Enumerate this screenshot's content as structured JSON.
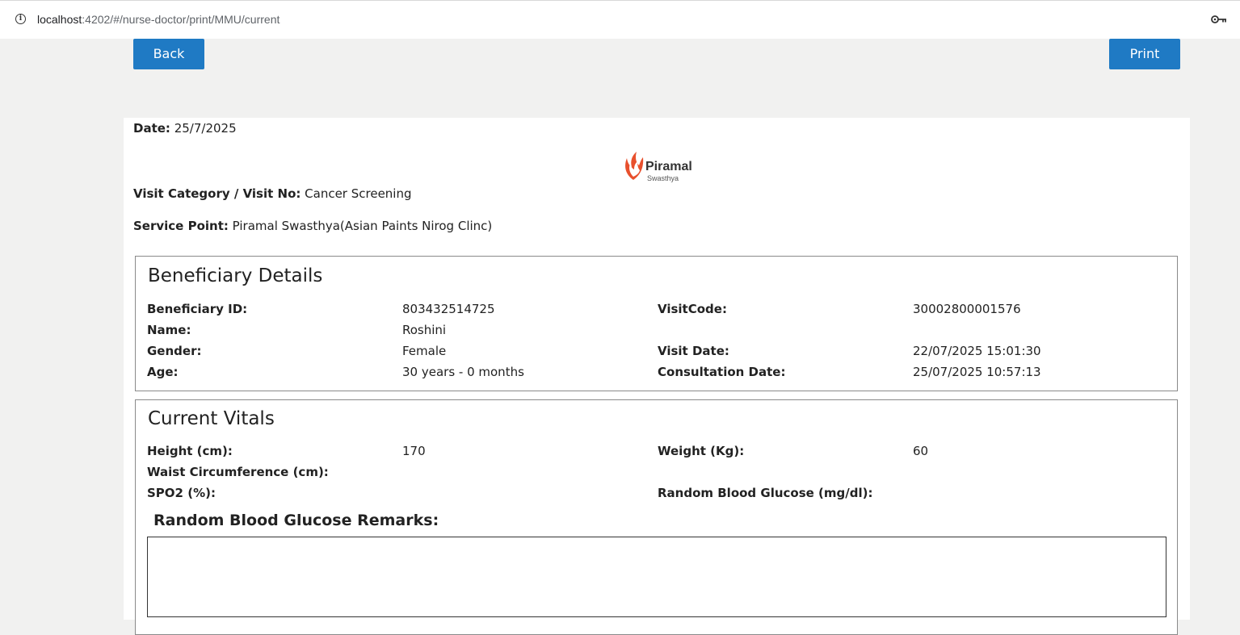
{
  "browser": {
    "url_host": "localhost",
    "url_path": ":4202/#/nurse-doctor/print/MMU/current"
  },
  "toolbar": {
    "back_label": "Back",
    "print_label": "Print"
  },
  "header": {
    "date_label": "Date:",
    "date_value": "25/7/2025",
    "visit_category_label": "Visit Category / Visit No:",
    "visit_category_value": "Cancer Screening",
    "service_point_label": "Service Point:",
    "service_point_value": "Piramal Swasthya(Asian Paints Nirog Clinc)",
    "logo_brand": "Piramal",
    "logo_sub": "Swasthya",
    "logo_color": "#e8502d"
  },
  "beneficiary": {
    "title": "Beneficiary Details",
    "id_label": "Beneficiary ID:",
    "id_value": "803432514725",
    "name_label": "Name:",
    "name_value": "Roshini",
    "gender_label": "Gender:",
    "gender_value": "Female",
    "age_label": "Age:",
    "age_value": "30 years - 0 months",
    "visitcode_label": "VisitCode:",
    "visitcode_value": "30002800001576",
    "visit_date_label": "Visit Date:",
    "visit_date_value": "22/07/2025 15:01:30",
    "consult_date_label": "Consultation Date:",
    "consult_date_value": "25/07/2025 10:57:13"
  },
  "vitals": {
    "title": "Current Vitals",
    "height_label": "Height (cm):",
    "height_value": "170",
    "weight_label": "Weight (Kg):",
    "weight_value": "60",
    "waist_label": "Waist Circumference (cm):",
    "spo2_label": "SPO2 (%):",
    "rbg_label": "Random Blood Glucose (mg/dl):",
    "remarks_label": "Random Blood Glucose Remarks:"
  },
  "colors": {
    "button_bg": "#1f7ac4",
    "page_bg": "#f1f1f0"
  }
}
